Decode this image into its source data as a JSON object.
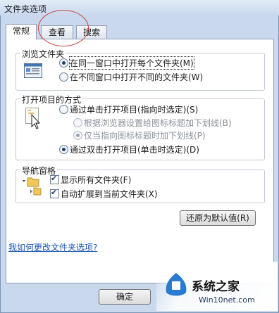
{
  "window": {
    "title": "文件夹选项"
  },
  "tabs": [
    {
      "label": "常规",
      "active": true
    },
    {
      "label": "查看",
      "active": false
    },
    {
      "label": "搜索",
      "active": false
    }
  ],
  "browse_folders": {
    "legend": "浏览文件夹",
    "options": [
      {
        "label": "在同一窗口中打开每个文件夹(M)",
        "checked": true
      },
      {
        "label": "在不同窗口中打开不同的文件夹(W)",
        "checked": false
      }
    ]
  },
  "open_items": {
    "legend": "打开项目的方式",
    "single_click": {
      "label": "通过单击打开项目(指向时选定)(S)",
      "checked": false
    },
    "sub_options": [
      {
        "label": "根据浏览器设置给图标标题加下划线(B)",
        "checked": false
      },
      {
        "label": "仅当指向图标标题时加下划线(P)",
        "checked": true
      }
    ],
    "double_click": {
      "label": "通过双击打开项目(单击时选定)(D)",
      "checked": true
    }
  },
  "navigation": {
    "legend": "导航窗格",
    "items": [
      {
        "label": "显示所有文件夹(F)",
        "checked": true
      },
      {
        "label": "自动扩展到当前文件夹(X)",
        "checked": true
      }
    ]
  },
  "buttons": {
    "restore_defaults": "还原为默认值(R)",
    "ok": "确定"
  },
  "help_link": "我如何更改文件夹选项?",
  "watermark": {
    "main": "系统之家",
    "sub": "Win10net.com"
  },
  "colors": {
    "accent_red": "#c94444",
    "link_blue": "#1a56b5"
  }
}
